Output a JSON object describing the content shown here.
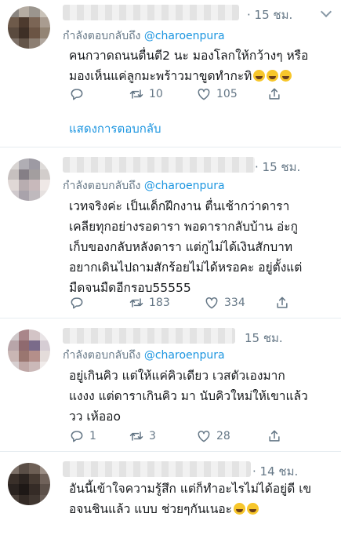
{
  "reply_prefix": "กำลังตอบกลับถึง",
  "show_replies_label": "แสดงการตอบกลับ",
  "accent_color": "#1b95e0",
  "icons": [
    "reply-icon",
    "retweet-icon",
    "like-icon",
    "share-icon",
    "chevron-down-icon"
  ],
  "tweets": [
    {
      "time": "· 15 ชม.",
      "reply_to": "@charoenpura",
      "text": "คนกวาดถนนตื่นตี2 นะ มองโลกให้กว้างๆ หรือ\nมองเห็นแค่ลูกมะพร้าวมาขูดทำกะทิ",
      "emoji_count": 3,
      "replies": "",
      "retweets": "10",
      "likes": "105"
    },
    {
      "time": "· 15 ชม.",
      "reply_to": "@charoenpura",
      "text": "เวทจริงค่ะ เป็นเด็กฝึกงาน ตื่นเช้ากว่าดารา\nเคลียทุกอย่างรอดารา พอดารากลับบ้าน อ่ะกู\nเก็บของกลับหลังดารา แต่กูไม่ได้เงินสักบาท\nอยากเดินไปถามสักร้อยไม่ได้หรอคะ อยู่ตั้งแต่\nมืดจนมืดอีกรอบ55555",
      "emoji_count": 0,
      "replies": "",
      "retweets": "183",
      "likes": "334"
    },
    {
      "time": "15 ชม.",
      "reply_to": "@charoenpura",
      "text": "อยู่เกินคิว แต่ให้แค่คิวเดียว เวสตัวเองมาก\nแงงง แต่ดาราเกินคิว มา นับคิวใหม่ให้เขาแล้ว\nวว เห้ออo",
      "emoji_count": 0,
      "replies": "1",
      "retweets": "3",
      "likes": "28"
    },
    {
      "time": "· 14 ชม.",
      "reply_to": "",
      "text": "อันนี้เข้าใจความรู้สึก แต่ก็ทำอะไรไม่ได้อยู่ดี เข\nอจนชินแล้ว แบบ ช่วยๆกันเนอะ",
      "emoji_count": 2,
      "replies": "",
      "retweets": "",
      "likes": ""
    }
  ]
}
